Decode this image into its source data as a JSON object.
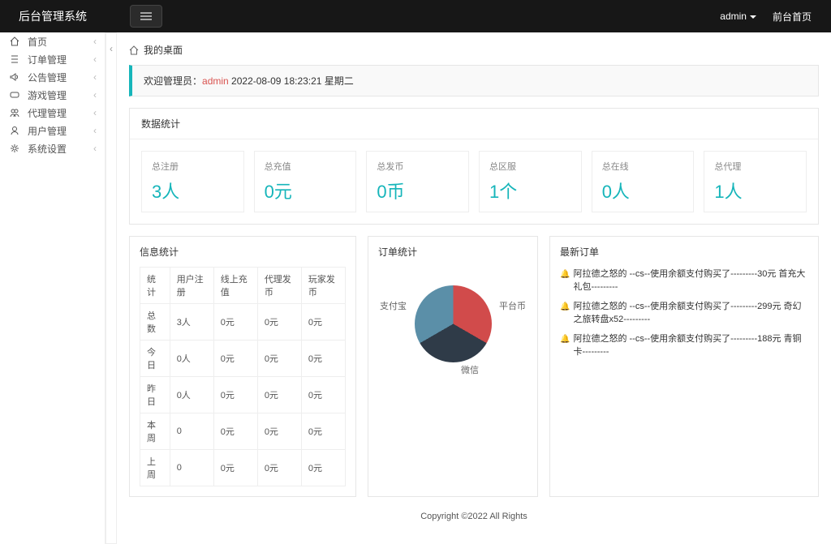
{
  "header": {
    "title": "后台管理系统",
    "user": "admin",
    "front": "前台首页"
  },
  "sidebar": {
    "items": [
      {
        "label": "首页"
      },
      {
        "label": "订单管理"
      },
      {
        "label": "公告管理"
      },
      {
        "label": "游戏管理"
      },
      {
        "label": "代理管理"
      },
      {
        "label": "用户管理"
      },
      {
        "label": "系统设置"
      }
    ]
  },
  "breadcrumb": {
    "label": "我的桌面"
  },
  "welcome": {
    "prefix": "欢迎管理员：",
    "user": "admin",
    "datetime": "2022-08-09  18:23:21  星期二"
  },
  "stats_panel": {
    "title": "数据统计",
    "items": [
      {
        "label": "总注册",
        "value": "3人"
      },
      {
        "label": "总充值",
        "value": "0元"
      },
      {
        "label": "总发币",
        "value": "0币"
      },
      {
        "label": "总区服",
        "value": "1个"
      },
      {
        "label": "总在线",
        "value": "0人"
      },
      {
        "label": "总代理",
        "value": "1人"
      }
    ]
  },
  "info_table": {
    "title": "信息统计",
    "headers": [
      "统计",
      "用户注册",
      "线上充值",
      "代理发币",
      "玩家发币"
    ],
    "rows": [
      [
        "总数",
        "3人",
        "0元",
        "0元",
        "0元"
      ],
      [
        "今日",
        "0人",
        "0元",
        "0元",
        "0元"
      ],
      [
        "昨日",
        "0人",
        "0元",
        "0元",
        "0元"
      ],
      [
        "本周",
        "0",
        "0元",
        "0元",
        "0元"
      ],
      [
        "上周",
        "0",
        "0元",
        "0元",
        "0元"
      ]
    ]
  },
  "chart_data": {
    "type": "pie",
    "title": "订单统计",
    "series": [
      {
        "name": "平台币",
        "value": 33.3,
        "color": "#d14b4b"
      },
      {
        "name": "微信",
        "value": 33.3,
        "color": "#2f3b48"
      },
      {
        "name": "支付宝",
        "value": 33.3,
        "color": "#5b8fa8"
      }
    ]
  },
  "orders": {
    "title": "最新订单",
    "items": [
      "阿拉德之怒的 --cs--使用余额支付购买了---------30元 首充大礼包---------",
      "阿拉德之怒的 --cs--使用余额支付购买了---------299元 奇幻之旅转盘x52---------",
      "阿拉德之怒的 --cs--使用余额支付购买了---------188元 青铜卡---------"
    ]
  },
  "footer": "Copyright ©2022 All Rights"
}
